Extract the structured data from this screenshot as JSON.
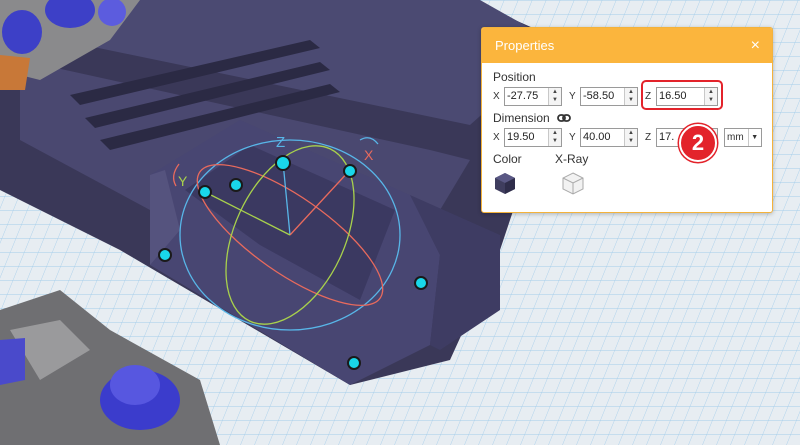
{
  "panel": {
    "title": "Properties",
    "close_glyph": "×",
    "position": {
      "label": "Position",
      "x_label": "X",
      "x_value": "-27.75",
      "y_label": "Y",
      "y_value": "-58.50",
      "z_label": "Z",
      "z_value": "16.50"
    },
    "dimension": {
      "label": "Dimension",
      "link_icon": "link-icon",
      "x_label": "X",
      "x_value": "19.50",
      "y_label": "Y",
      "y_value": "40.00",
      "z_label": "Z",
      "z_value": "17.",
      "unit": "mm"
    },
    "color": {
      "label": "Color",
      "icon": "cube-solid-icon"
    },
    "xray": {
      "label": "X-Ray",
      "icon": "cube-wireframe-icon"
    }
  },
  "annotation": {
    "step_number": "2",
    "color": "#e3232b"
  },
  "gizmo": {
    "x_label": "X",
    "y_label": "Y",
    "z_label": "Z"
  },
  "colors": {
    "accent": "#fbb53d",
    "model": "#3f3d5e",
    "grid_bg": "#dfe7ee",
    "grid_line": "#8fc3e8",
    "handle": "#19d7ea"
  }
}
